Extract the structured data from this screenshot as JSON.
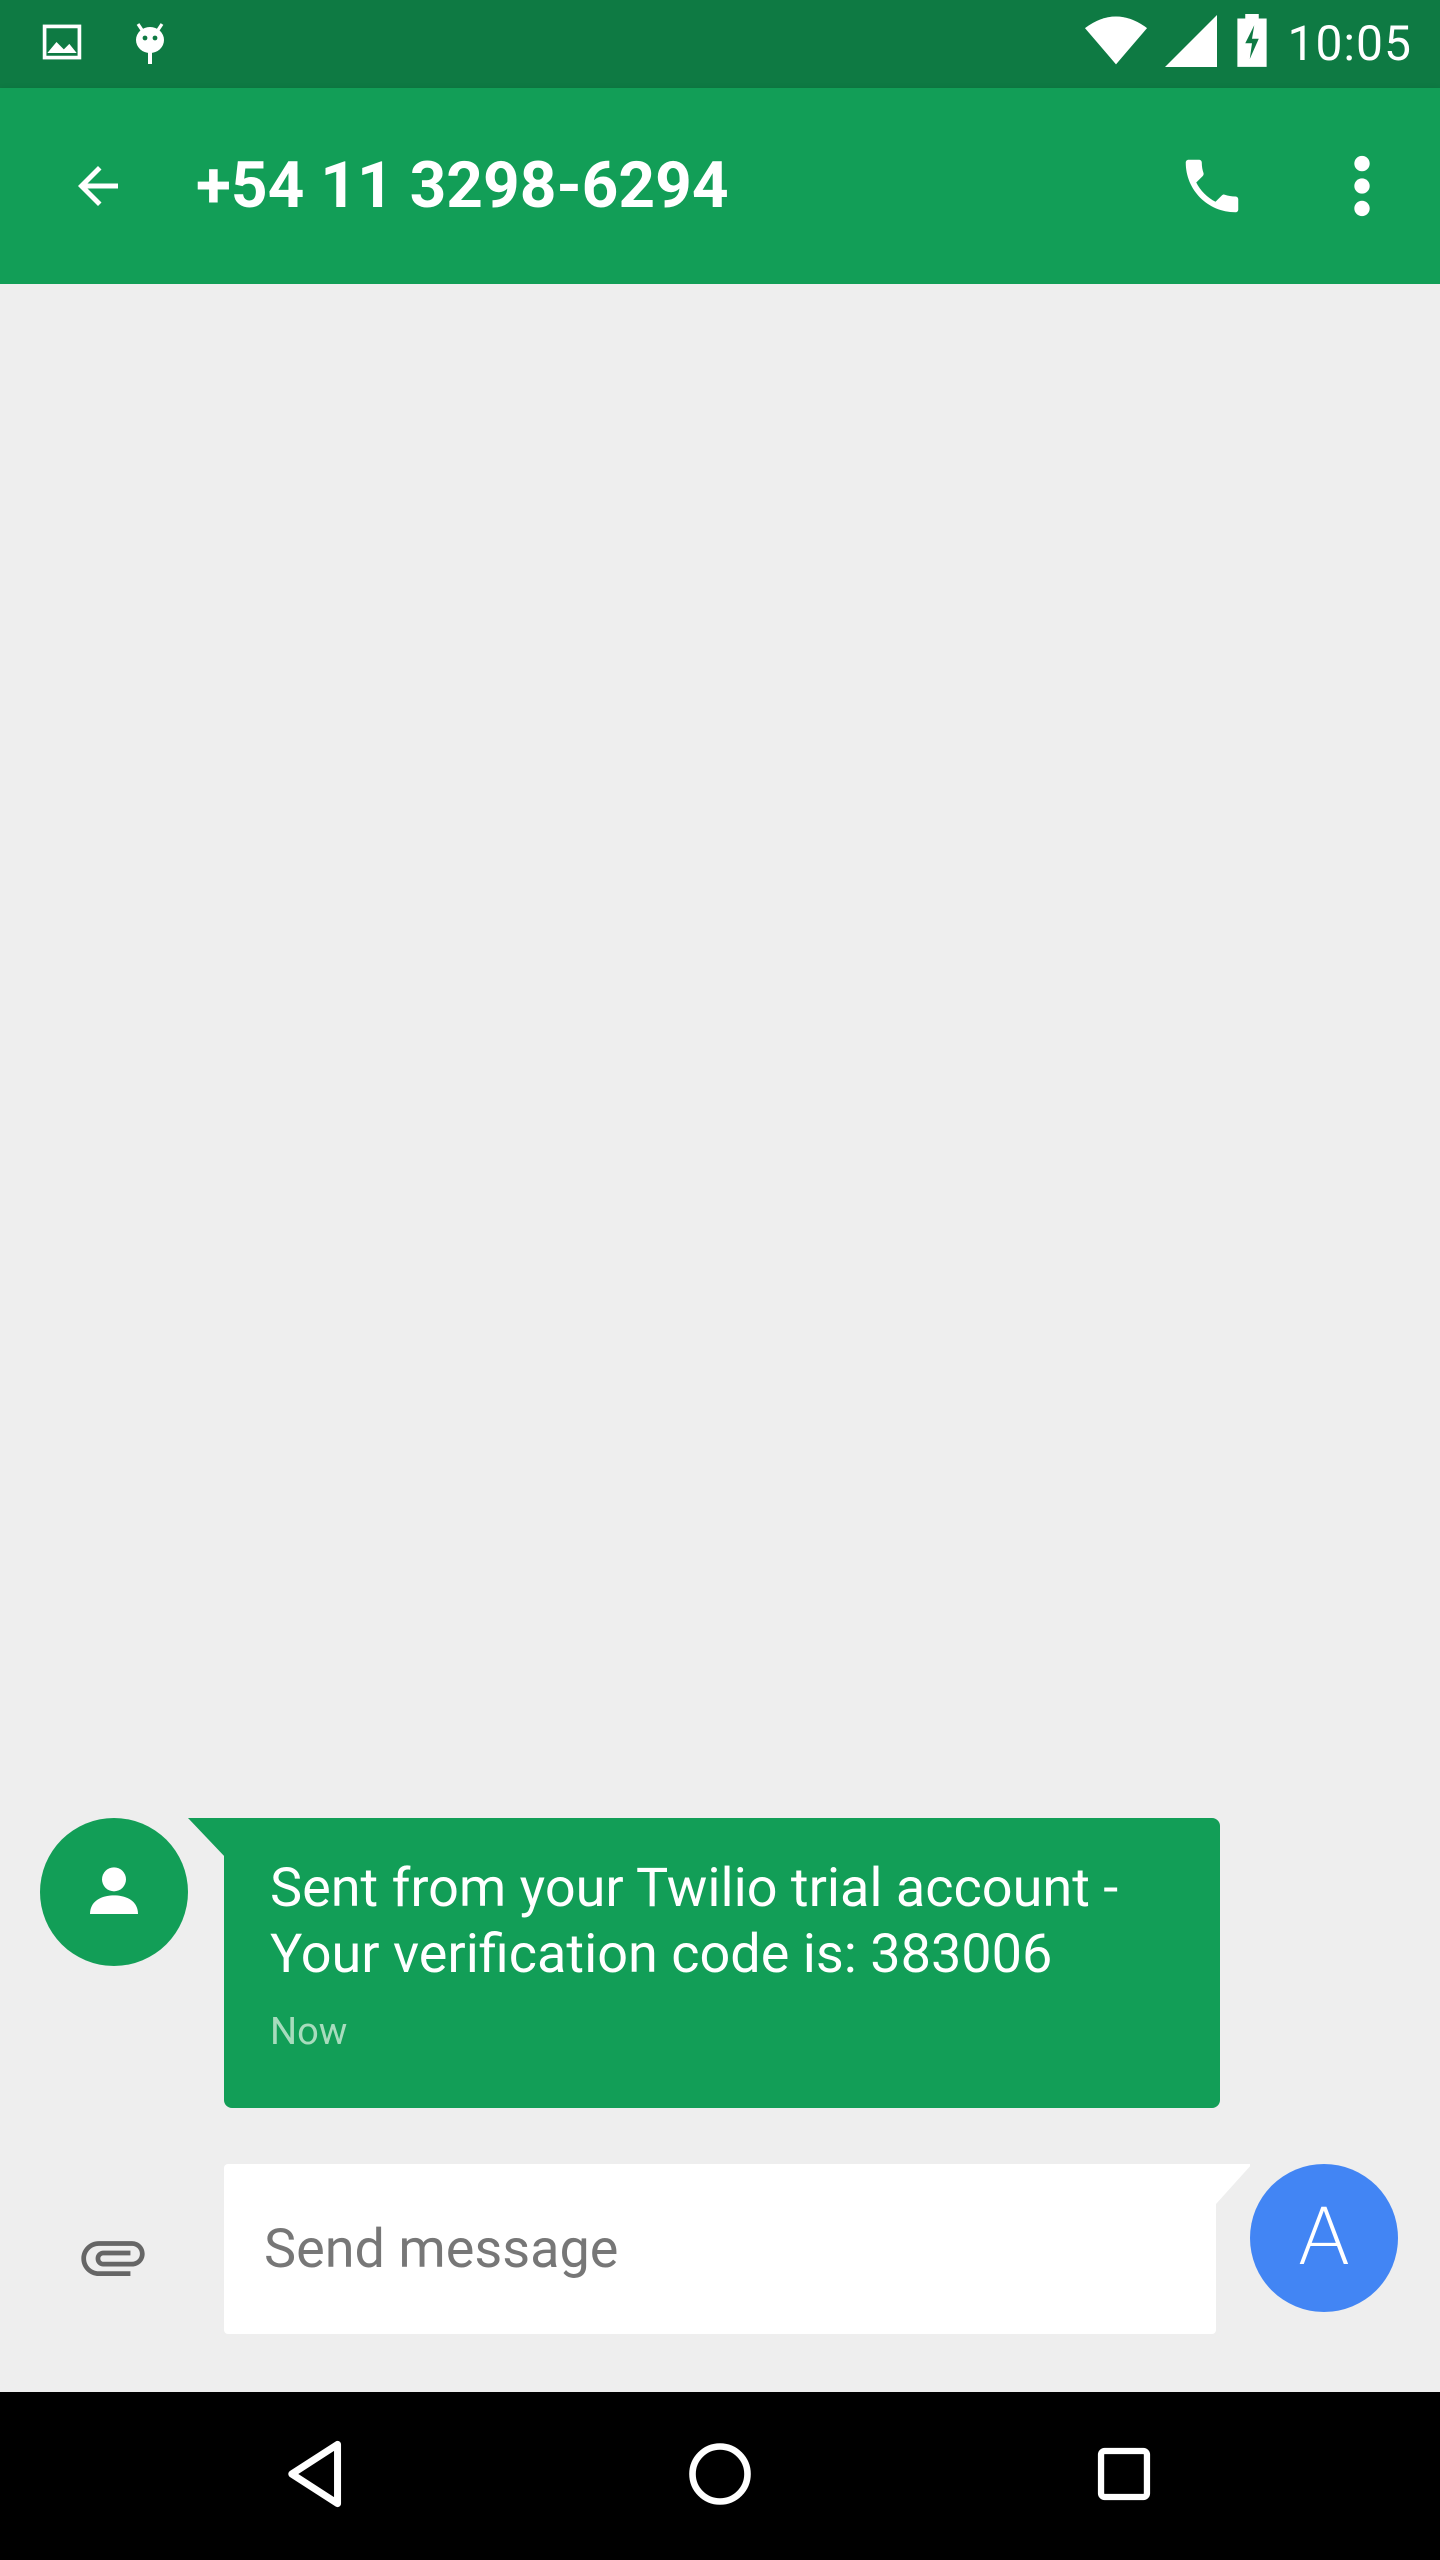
{
  "status_bar": {
    "time": "10:05",
    "icons": [
      "image-notification-icon",
      "android-debug-icon",
      "wifi-icon",
      "cell-signal-icon",
      "battery-charging-icon"
    ]
  },
  "header": {
    "title": "+54 11 3298-6294",
    "icons": [
      "back-arrow-icon",
      "phone-icon",
      "more-vert-icon"
    ]
  },
  "messages": [
    {
      "text_line_1": "Sent from your Twilio trial account -",
      "text_line_2": "Your verification code is: 383006",
      "time": "Now",
      "avatar_icon": "person-icon"
    }
  ],
  "compose": {
    "placeholder": "Send message",
    "value": "",
    "attach_icon": "paperclip-icon",
    "send_label": "A"
  },
  "nav_bar": {
    "icons": [
      "back-triangle-icon",
      "home-circle-icon",
      "recents-square-icon"
    ]
  },
  "colors": {
    "status_bar": "#0e7a43",
    "app_bar": "#129e57",
    "bubble": "#129e57",
    "background": "#eeeeee",
    "send_button": "#4285f4",
    "timestamp": "#a7dcbd"
  }
}
